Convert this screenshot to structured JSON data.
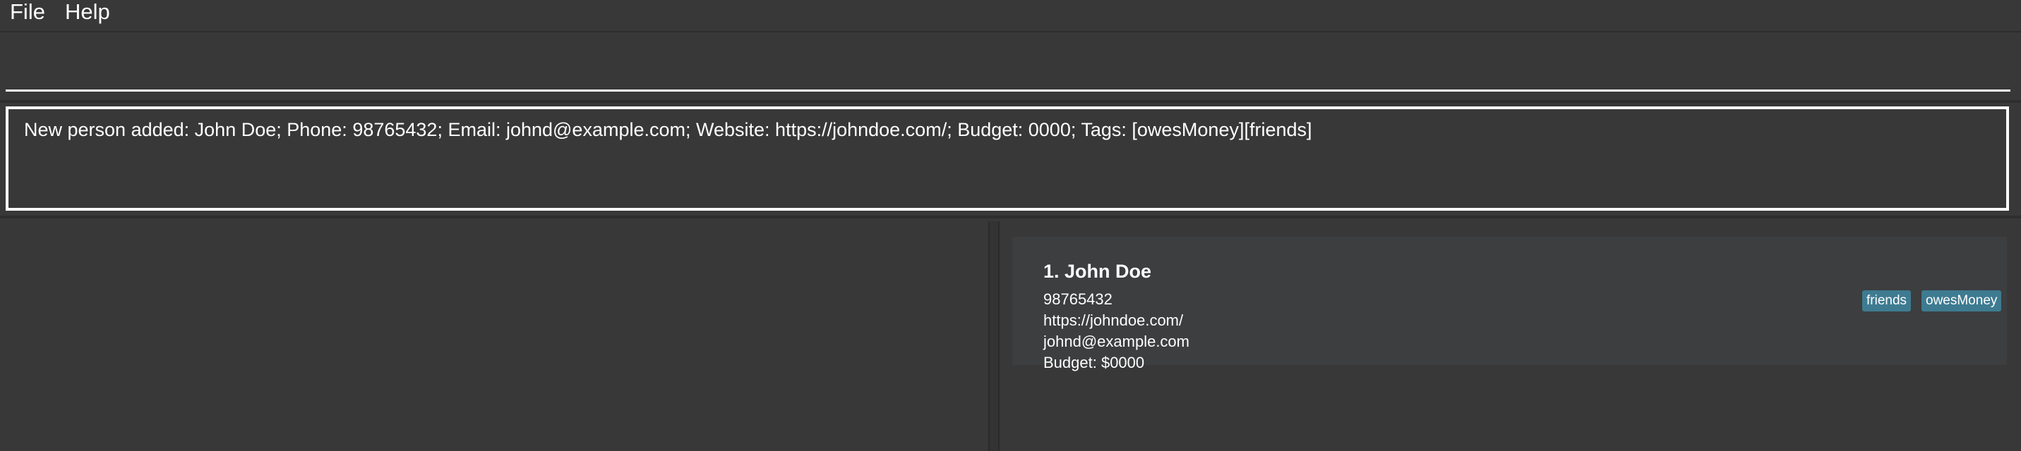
{
  "menu": {
    "file_label": "File",
    "help_label": "Help"
  },
  "command": {
    "value": "",
    "placeholder": ""
  },
  "result": {
    "message": "New person added: John Doe; Phone: 98765432; Email: johnd@example.com; Website: https://johndoe.com/; Budget: 0000; Tags: [owesMoney][friends]"
  },
  "persons": [
    {
      "header": "1. John Doe",
      "phone": "98765432",
      "website": "https://johndoe.com/",
      "email": "johnd@example.com",
      "budget": "Budget: $0000",
      "tags": [
        "friends",
        "owesMoney"
      ]
    }
  ],
  "colors": {
    "background": "#383838",
    "card": "#3c3e3f",
    "tag": "#3e7b91",
    "text": "#ffffff"
  }
}
